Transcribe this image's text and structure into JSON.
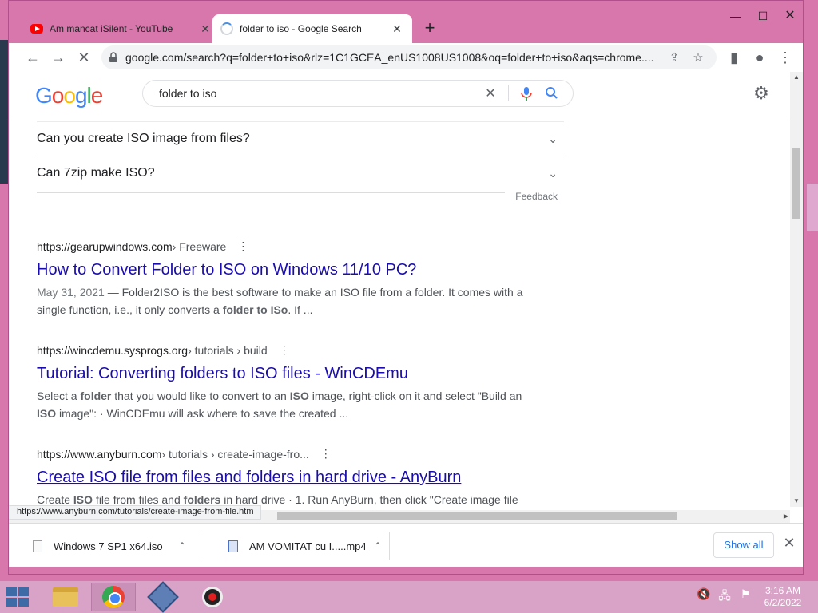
{
  "tabs": [
    {
      "label": "Am mancat iSilent - YouTube",
      "icon": "youtube-icon",
      "close": "✕"
    },
    {
      "label": "folder to iso - Google Search",
      "icon": "loading-spinner-icon",
      "close": "✕"
    }
  ],
  "new_tab": "+",
  "window_controls": {
    "minimize": "—",
    "maximize": "☐",
    "close": "✕"
  },
  "toolbar": {
    "back": "←",
    "forward": "→",
    "stop": "✕",
    "url": "google.com/search?q=folder+to+iso&rlz=1C1GCEA_enUS1008US1008&oq=folder+to+iso&aqs=chrome....",
    "share": "⇪",
    "bookmark": "☆",
    "sidepanel": "▮",
    "profile": "●",
    "menu": "⋮"
  },
  "google": {
    "logo": [
      "G",
      "o",
      "o",
      "g",
      "l",
      "e"
    ],
    "query": "folder to iso",
    "clear": "✕",
    "mic": "🎤",
    "search": "🔍",
    "settings": "⚙"
  },
  "faqs": [
    {
      "question": "Can you create ISO image from files?",
      "chevron": "⌄"
    },
    {
      "question": "Can 7zip make ISO?",
      "chevron": "⌄"
    }
  ],
  "feedback": "Feedback",
  "results": [
    {
      "site": "https://gearupwindows.com",
      "breadcrumb": " › Freeware",
      "title": "How to Convert Folder to ISO on Windows 11/10 PC?",
      "snippet_date": "May 31, 2021",
      "snippet_1": " — Folder2ISO is the best software to make an ISO file from a folder. It comes with a single function, i.e., it only converts a ",
      "snippet_b1": "folder to ISo",
      "snippet_2": ". If ..."
    },
    {
      "site": "https://wincdemu.sysprogs.org",
      "breadcrumb": " › tutorials › build",
      "title": "Tutorial: Converting folders to ISO files - WinCDEmu",
      "snippet_a": "Select a ",
      "snippet_b1": "folder",
      "snippet_c": " that you would like to convert to an ",
      "snippet_b2": "ISO",
      "snippet_d": " image, right-click on it and select \"Build an ",
      "snippet_b3": "ISO",
      "snippet_e": " image\": · WinCDEmu will ask where to save the created ..."
    },
    {
      "site": "https://www.anyburn.com",
      "breadcrumb": " › tutorials › create-image-fro...",
      "title": "Create ISO file from files and folders in hard drive - AnyBurn",
      "snippet_a": "Create ",
      "snippet_b1": "ISO",
      "snippet_c": " file from files and ",
      "snippet_b2": "folders",
      "snippet_d": " in hard drive · 1. Run AnyBurn, then click \"Create image file"
    }
  ],
  "more_dots": "⋮",
  "status_url": "https://www.anyburn.com/tutorials/create-image-from-file.htm",
  "downloads": [
    {
      "name": "Windows 7 SP1 x64.iso",
      "chevron": "⌃"
    },
    {
      "name": "AM VOMITAT cu I.....mp4",
      "chevron": "⌃"
    }
  ],
  "show_all": "Show all",
  "shelf_close": "✕",
  "taskbar": {
    "apps": [
      "file-explorer-icon",
      "chrome-icon",
      "virtualbox-icon",
      "screen-recorder-icon"
    ],
    "tray": [
      "🔇",
      "🖧",
      "⚑"
    ],
    "time": "3:16 AM",
    "date": "6/2/2022"
  },
  "colors": {
    "link": "#1a0dab",
    "frame": "#d877ab",
    "taskbar": "#d9a3c8"
  }
}
